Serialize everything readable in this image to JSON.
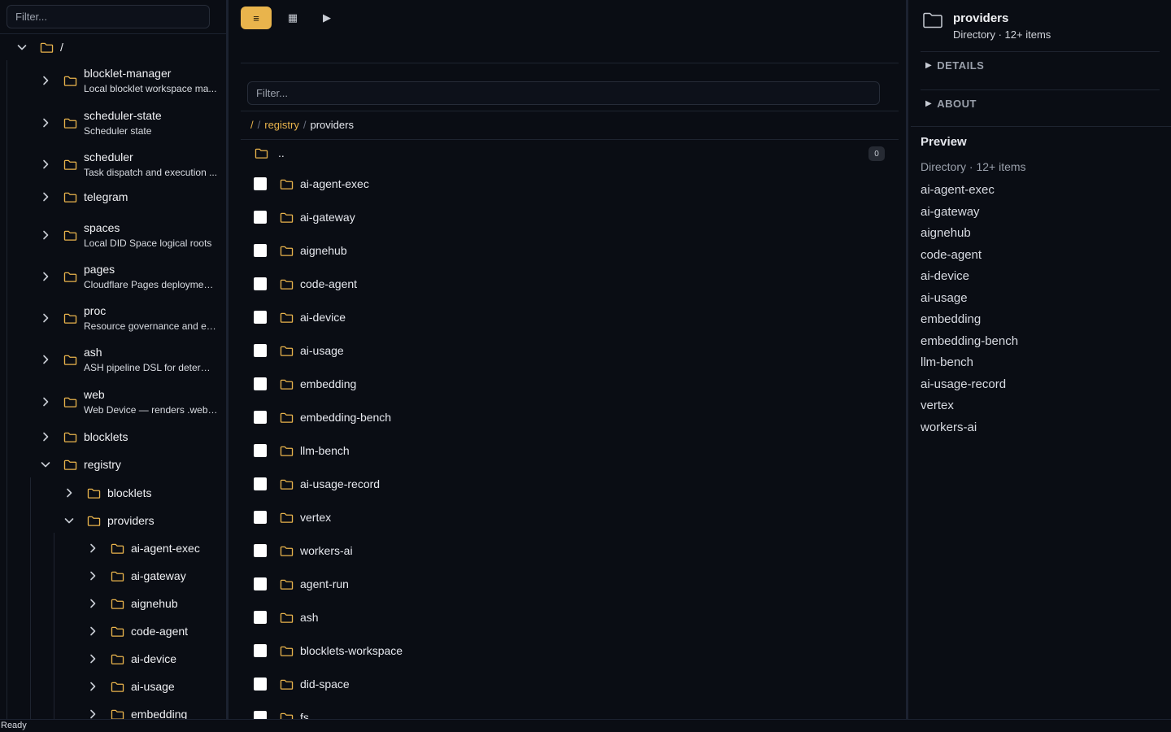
{
  "sidebar": {
    "filter_placeholder": "Filter...",
    "root_label": "/",
    "items": [
      {
        "label": "blocklet-manager",
        "desc": "Local blocklet workspace ma..."
      },
      {
        "label": "scheduler-state",
        "desc": "Scheduler state"
      },
      {
        "label": "scheduler",
        "desc": "Task dispatch and execution ..."
      },
      {
        "label": "telegram",
        "desc": ""
      },
      {
        "label": "spaces",
        "desc": "Local DID Space logical roots"
      },
      {
        "label": "pages",
        "desc": "Cloudflare Pages deployment..."
      },
      {
        "label": "proc",
        "desc": "Resource governance and ex..."
      },
      {
        "label": "ash",
        "desc": "ASH pipeline DSL for determi..."
      },
      {
        "label": "web",
        "desc": "Web Device — renders .web/..."
      },
      {
        "label": "blocklets",
        "desc": ""
      },
      {
        "label": "registry",
        "desc": ""
      }
    ],
    "registry_children": [
      {
        "label": "blocklets"
      },
      {
        "label": "providers"
      }
    ],
    "provider_children": [
      {
        "label": "ai-agent-exec"
      },
      {
        "label": "ai-gateway"
      },
      {
        "label": "aignehub"
      },
      {
        "label": "code-agent"
      },
      {
        "label": "ai-device"
      },
      {
        "label": "ai-usage"
      },
      {
        "label": "embedding"
      }
    ]
  },
  "toolbar": {
    "list_icon": "≡",
    "grid_icon": "▦",
    "play_icon": "▶"
  },
  "main": {
    "filter_placeholder": "Filter...",
    "breadcrumb": {
      "root": "/",
      "sep": "/",
      "parent": "registry",
      "current": "providers"
    },
    "up_label": "..",
    "count": "0",
    "files": [
      "ai-agent-exec",
      "ai-gateway",
      "aignehub",
      "code-agent",
      "ai-device",
      "ai-usage",
      "embedding",
      "embedding-bench",
      "llm-bench",
      "ai-usage-record",
      "vertex",
      "workers-ai",
      "agent-run",
      "ash",
      "blocklets-workspace",
      "did-space",
      "fs"
    ]
  },
  "right": {
    "title": "providers",
    "subtitle": "Directory · 12+ items",
    "details_label": "DETAILS",
    "about_label": "ABOUT",
    "preview_title": "Preview",
    "preview_sub": "Directory · 12+ items",
    "preview_items": [
      "ai-agent-exec",
      "ai-gateway",
      "aignehub",
      "code-agent",
      "ai-device",
      "ai-usage",
      "embedding",
      "embedding-bench",
      "llm-bench",
      "ai-usage-record",
      "vertex",
      "workers-ai"
    ]
  },
  "status": {
    "text": "Ready"
  },
  "colors": {
    "accent": "#e9b44c",
    "background": "#0a0d14"
  }
}
